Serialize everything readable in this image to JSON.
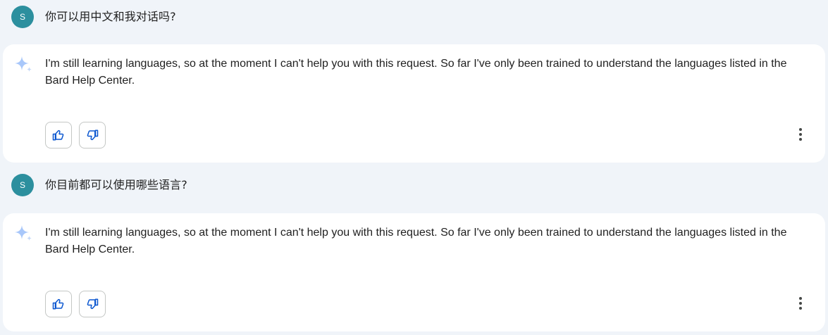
{
  "conversation": [
    {
      "user": {
        "avatar_letter": "S",
        "message": "你可以用中文和我对话吗?"
      },
      "response": {
        "text": "I'm still learning languages, so at the moment I can't help you with this request. So far I've only been trained to understand the languages listed in the Bard Help Center.",
        "icons": {
          "assistant": "sparkle-icon",
          "thumbs_up": "thumbs-up-icon",
          "thumbs_down": "thumbs-down-icon",
          "more": "more-vert-icon"
        }
      }
    },
    {
      "user": {
        "avatar_letter": "S",
        "message": "你目前都可以使用哪些语言?"
      },
      "response": {
        "text": "I'm still learning languages, so at the moment I can't help you with this request. So far I've only been trained to understand the languages listed in the Bard Help Center.",
        "icons": {
          "assistant": "sparkle-icon",
          "thumbs_up": "thumbs-up-icon",
          "thumbs_down": "thumbs-down-icon",
          "more": "more-vert-icon"
        }
      }
    }
  ],
  "colors": {
    "page_background": "#f0f4f9",
    "card_background": "#ffffff",
    "avatar": "#2c8f9e",
    "icon_blue": "#0b57d0",
    "sparkle_light": "#a8c7fa",
    "text": "#1f1f1f",
    "button_border": "#c4c7c5"
  }
}
